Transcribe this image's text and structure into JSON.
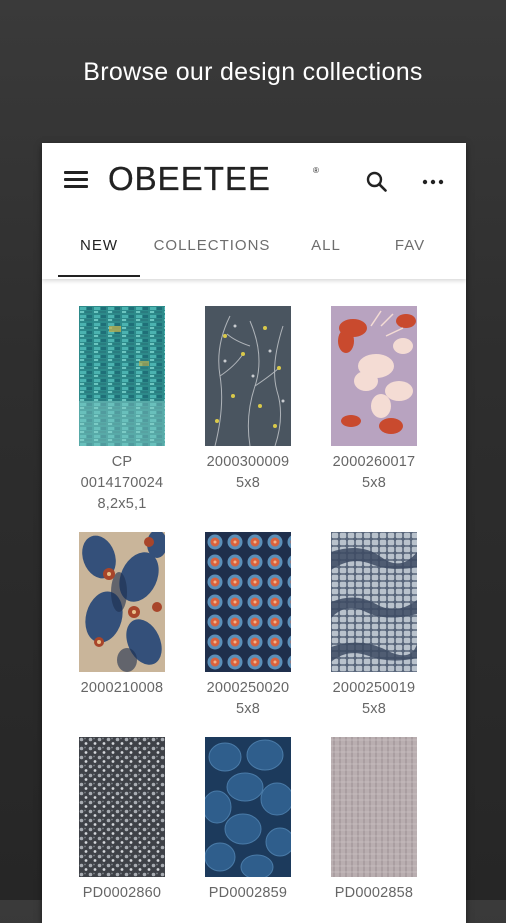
{
  "promo_title": "Browse our design collections",
  "app": {
    "logo": "OBEETEE",
    "logo_mark": "®",
    "icons": {
      "menu": "hamburger-menu-icon",
      "search": "search-icon",
      "more": "more-vert-icon"
    }
  },
  "tabs": [
    {
      "label": "NEW",
      "active": true
    },
    {
      "label": "COLLECTIONS",
      "active": false
    },
    {
      "label": "ALL",
      "active": false
    },
    {
      "label": "FAV",
      "active": false
    }
  ],
  "colors": {
    "accent": "#222222",
    "background": "#2e2e2e",
    "card": "#ffffff",
    "caption": "#666666"
  },
  "products": [
    {
      "line1": "CP",
      "line2": "0014170024",
      "line3": "8,2x5,1",
      "pattern": "teal-mosaic"
    },
    {
      "line1": "2000300009",
      "line2": "5x8",
      "line3": "",
      "pattern": "slate-branches"
    },
    {
      "line1": "2000260017",
      "line2": "5x8",
      "line3": "",
      "pattern": "lilac-floral"
    },
    {
      "line1": "2000210008",
      "line2": "",
      "line3": "",
      "pattern": "navy-botanical"
    },
    {
      "line1": "2000250020",
      "line2": "5x8",
      "line3": "",
      "pattern": "navy-dots"
    },
    {
      "line1": "2000250019",
      "line2": "5x8",
      "line3": "",
      "pattern": "grey-stripe-mosaic"
    },
    {
      "line1": "PD0002860",
      "line2": "",
      "line3": "",
      "pattern": "charcoal-speckle"
    },
    {
      "line1": "PD0002859",
      "line2": "",
      "line3": "",
      "pattern": "blue-petals"
    },
    {
      "line1": "PD0002858",
      "line2": "",
      "line3": "",
      "pattern": "taupe-weave"
    }
  ]
}
